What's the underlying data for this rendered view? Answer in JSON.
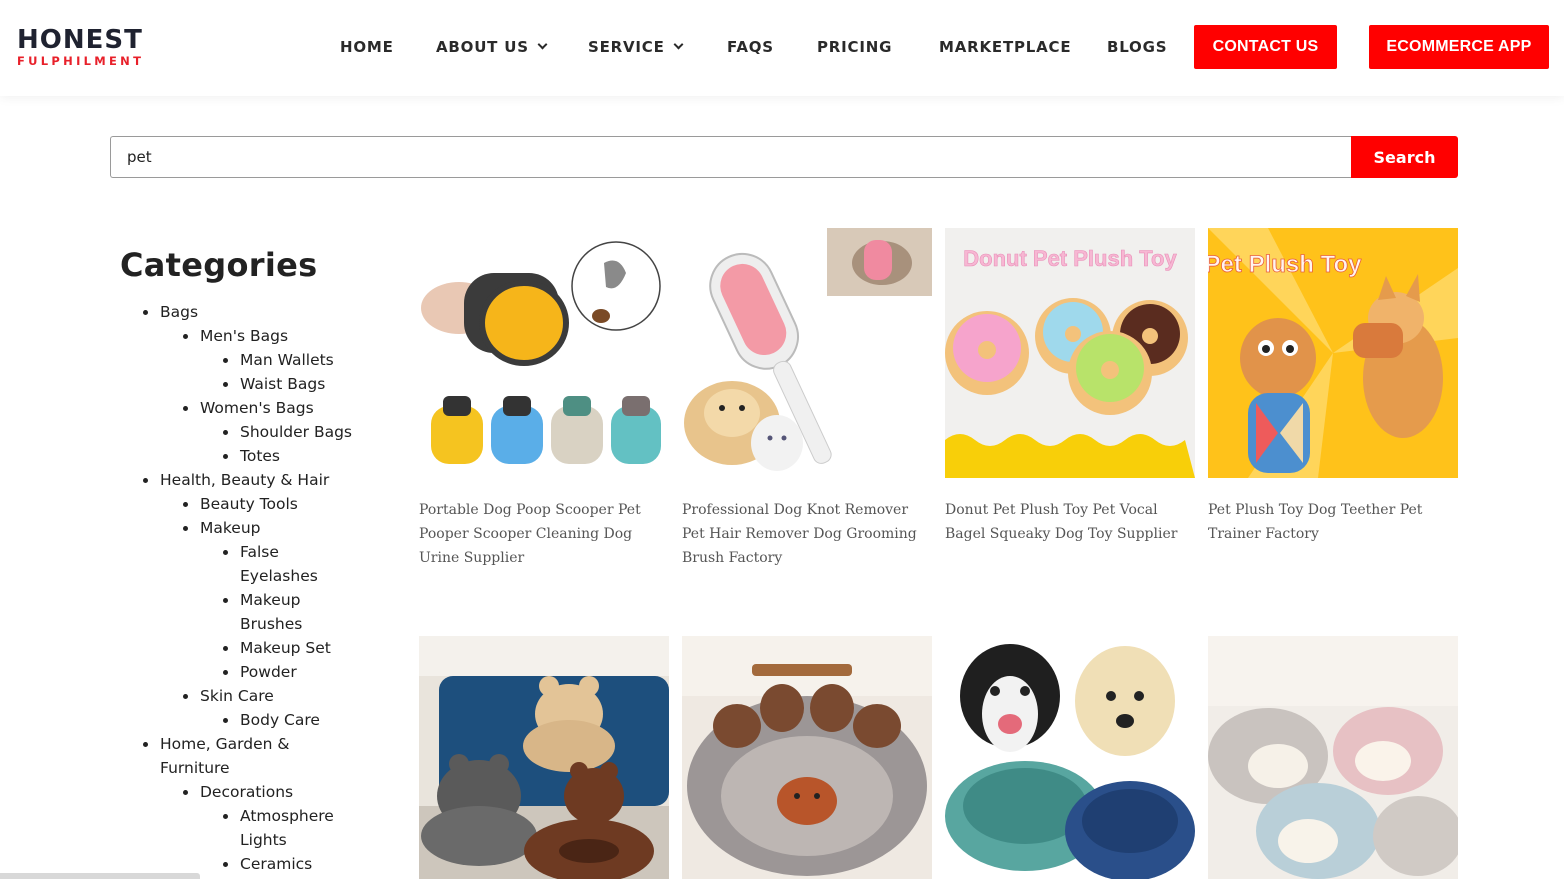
{
  "logo": {
    "top": "HONEST",
    "bottom": "FULPHILMENT"
  },
  "nav": {
    "home": "HOME",
    "about": "ABOUT US",
    "service": "SERVICE",
    "faqs": "FAQS",
    "pricing": "PRICING",
    "marketplace": "MARKETPLACE",
    "blogs": "BLOGS",
    "contact": "CONTACT US",
    "ecommerce": "ECOMMERCE APP"
  },
  "search": {
    "value": "pet",
    "button": "Search"
  },
  "categories": {
    "title": "Categories",
    "items": [
      "Bags",
      "Men's Bags",
      "Man Wallets",
      "Waist Bags",
      "Women's Bags",
      "Shoulder Bags",
      "Totes",
      "Health, Beauty & Hair",
      "Beauty Tools",
      "Makeup",
      "False",
      "Eyelashes",
      "Makeup",
      "Brushes",
      "Makeup Set",
      "Powder",
      "Skin Care",
      "Body Care",
      "Home, Garden &",
      "Furniture",
      "Decorations",
      "Atmosphere",
      "Lights",
      "Ceramics"
    ]
  },
  "products": [
    {
      "title": "Portable Dog Poop Scooper Pet Pooper Scooper Cleaning Dog Urine Supplier",
      "image_text": ""
    },
    {
      "title": "Professional Dog Knot Remover Pet Hair Remover Dog Grooming Brush Factory",
      "image_text": ""
    },
    {
      "title": "Donut Pet Plush Toy Pet Vocal Bagel Squeaky Dog Toy Supplier",
      "image_text": "Donut Pet Plush Toy"
    },
    {
      "title": "Pet Plush Toy Dog Teether Pet Trainer Factory",
      "image_text": "Pet Plush Toy"
    },
    {
      "title": "",
      "image_text": ""
    },
    {
      "title": "",
      "image_text": ""
    },
    {
      "title": "",
      "image_text": ""
    },
    {
      "title": "",
      "image_text": ""
    }
  ],
  "colors": {
    "accent": "#ff0000",
    "brand_dark": "#1f2230"
  }
}
